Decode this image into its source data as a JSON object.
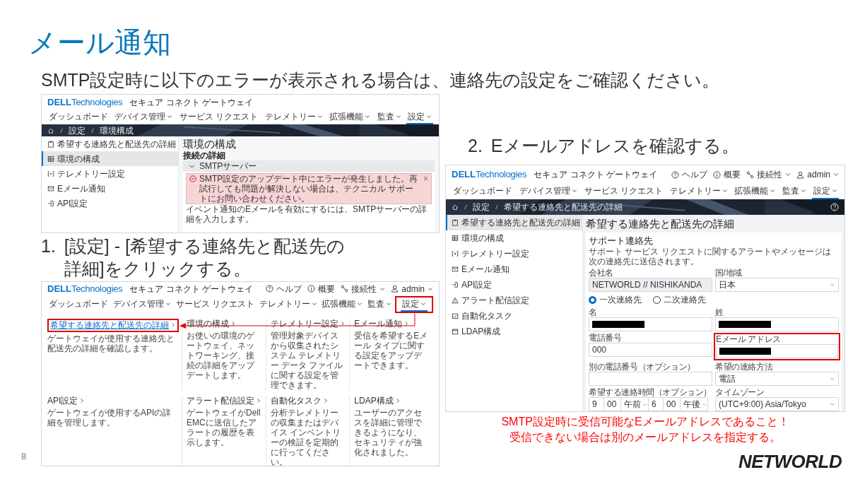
{
  "slide": {
    "title": "メール通知",
    "subtitle": "SMTP設定時に以下のエラーが表示される場合は、連絡先の設定をご確認ください。",
    "page_number": "8",
    "logo": "NETWORLD"
  },
  "step_1": {
    "number": "1.",
    "text": "[設定] - [希望する連絡先と配送先の詳細]をクリックする。"
  },
  "step_2": {
    "number": "2.",
    "text": "Eメールアドレスを確認する。"
  },
  "note": [
    "SMTP設定時に受信可能なEメールアドレスであること！",
    "受信できない場合は別のメールアドレスを指定する。"
  ],
  "screenshot_1": {
    "brand": {
      "mark": "DELL",
      "name": "Technologies"
    },
    "app_title": "セキュア コネクト ゲートウェイ",
    "nav": [
      {
        "label": "ダッシュボード",
        "dropdown": false,
        "selected": false
      },
      {
        "label": "デバイス管理",
        "dropdown": true,
        "selected": false
      },
      {
        "label": "サービス リクエスト",
        "dropdown": false,
        "selected": false
      },
      {
        "label": "テレメトリー",
        "dropdown": true,
        "selected": false
      },
      {
        "label": "拡張機能",
        "dropdown": true,
        "selected": false
      },
      {
        "label": "監査",
        "dropdown": true,
        "selected": false
      },
      {
        "label": "設定",
        "dropdown": true,
        "selected": true
      }
    ],
    "breadcrumb": [
      "設定",
      "環境構成"
    ],
    "sidebar": [
      {
        "label": "希望する連絡先と配送先の詳細",
        "selected": false
      },
      {
        "label": "環境の構成",
        "selected": true
      },
      {
        "label": "テレメトリー設定",
        "selected": false
      },
      {
        "label": "Eメール通知",
        "selected": false
      },
      {
        "label": "API設定",
        "selected": false
      }
    ],
    "heading": "環境の構成",
    "section": "接続の詳細",
    "accordion": {
      "title": "SMTPサーバー",
      "expanded": true
    },
    "error": {
      "message": "SMTP設定のアップデート中にエラーが発生しました。再試行しても問題が解決しない場合は、テクニカル サポートにお問い合わせください。",
      "close": "×"
    },
    "info": "イベント通知のEメールを有効にするには、SMTPサーバーの詳細を入力します。"
  },
  "screenshot_2": {
    "brand": {
      "mark": "DELL",
      "name": "Technologies"
    },
    "app_title": "セキュア コネクト ゲートウェイ",
    "utilities": [
      {
        "label": "ヘルプ",
        "dropdown": false
      },
      {
        "label": "概要",
        "dropdown": false
      },
      {
        "label": "接続性",
        "dropdown": true
      },
      {
        "label": "admin",
        "dropdown": true
      }
    ],
    "nav": [
      {
        "label": "ダッシュボード",
        "dropdown": false,
        "selected": false,
        "highlighted": false
      },
      {
        "label": "デバイス管理",
        "dropdown": true,
        "selected": false,
        "highlighted": false
      },
      {
        "label": "サービス リクエスト",
        "dropdown": false,
        "selected": false,
        "highlighted": false
      },
      {
        "label": "テレメトリー",
        "dropdown": true,
        "selected": false,
        "highlighted": false
      },
      {
        "label": "拡張機能",
        "dropdown": true,
        "selected": false,
        "highlighted": false
      },
      {
        "label": "監査",
        "dropdown": true,
        "selected": false,
        "highlighted": false
      },
      {
        "label": "設定",
        "dropdown": true,
        "selected": true,
        "highlighted": true
      }
    ],
    "menu": [
      {
        "title": "希望する連絡先と配送先の詳細",
        "description": "ゲートウェイが使用する連絡先と配送先の詳細を確認します。",
        "active": true,
        "highlighted": true
      },
      {
        "title": "環境の構成",
        "description": "お使いの環境のゲートウェイ、ネットワーキング、接続の詳細をアップデートします。",
        "active": false,
        "highlighted": false
      },
      {
        "title": "テレメトリー設定",
        "description": "管理対象デバイスから収集されたシステム テレメトリー データ ファイルに関する設定を管理できます。",
        "active": false,
        "highlighted": false
      },
      {
        "title": "Eメール通知",
        "description": "受信を希望するEメール タイプに関する設定をアップデートできます。",
        "active": false,
        "highlighted": false
      },
      {
        "title": "API設定",
        "description": "ゲートウェイが使用するAPIの詳細を管理します。",
        "active": false,
        "highlighted": false
      },
      {
        "title": "アラート配信設定",
        "description": "ゲートウェイがDell EMCに送信したアラートの履歴を表示します。",
        "active": false,
        "highlighted": false
      },
      {
        "title": "自動化タスク",
        "description": "分析テレメトリーの収集またはデバイス インベントリーの検証を定期的に行ってください。",
        "active": false,
        "highlighted": false
      },
      {
        "title": "LDAP構成",
        "description": "ユーザーのアクセスを詳細に管理できるようになり、セキュリティが強化されました。",
        "active": false,
        "highlighted": false
      }
    ]
  },
  "screenshot_3": {
    "brand": {
      "mark": "DELL",
      "name": "Technologies"
    },
    "app_title": "セキュア コネクト ゲートウェイ",
    "utilities": [
      {
        "label": "ヘルプ",
        "dropdown": false
      },
      {
        "label": "概要",
        "dropdown": false
      },
      {
        "label": "接続性",
        "dropdown": true
      },
      {
        "label": "admin",
        "dropdown": true
      }
    ],
    "nav": [
      {
        "label": "ダッシュボード",
        "dropdown": false,
        "selected": false
      },
      {
        "label": "デバイス管理",
        "dropdown": true,
        "selected": false
      },
      {
        "label": "サービス リクエスト",
        "dropdown": false,
        "selected": false
      },
      {
        "label": "テレメトリー",
        "dropdown": true,
        "selected": false
      },
      {
        "label": "拡張機能",
        "dropdown": true,
        "selected": false
      },
      {
        "label": "監査",
        "dropdown": true,
        "selected": false
      },
      {
        "label": "設定",
        "dropdown": true,
        "selected": true
      }
    ],
    "breadcrumb": [
      "設定",
      "希望する連絡先と配送先の詳細"
    ],
    "sidebar": [
      {
        "label": "希望する連絡先と配送先の詳細",
        "selected": true
      },
      {
        "label": "環境の構成",
        "selected": false
      },
      {
        "label": "テレメトリー設定",
        "selected": false
      },
      {
        "label": "Eメール通知",
        "selected": false
      },
      {
        "label": "API設定",
        "selected": false
      },
      {
        "label": "アラート配信設定",
        "selected": false
      },
      {
        "label": "自動化タスク",
        "selected": false
      },
      {
        "label": "LDAP構成",
        "selected": false
      }
    ],
    "heading": "希望する連絡先と配送先の詳細",
    "card": {
      "title": "サポート連絡先",
      "description": "サポート サービス リクエストに関するアラートやメッセージは次の連絡先に送信されます。",
      "fields": [
        {
          "kind": "text",
          "label": "会社名",
          "value": "NETWORLD // NISHIKANDA",
          "disabled": true,
          "redacted": false,
          "highlighted": false
        },
        {
          "kind": "select",
          "label": "国/地域",
          "value": "日本"
        },
        {
          "kind": "radio_group",
          "options": [
            {
              "label": "一次連絡先",
              "selected": true
            },
            {
              "label": "二次連絡先",
              "selected": false
            }
          ]
        },
        {
          "kind": "text",
          "label": "名",
          "disabled": false,
          "redacted": true,
          "highlighted": false
        },
        {
          "kind": "text",
          "label": "姓",
          "disabled": false,
          "redacted": true,
          "highlighted": false
        },
        {
          "kind": "text",
          "label": "電話番号",
          "value": "000",
          "disabled": false,
          "redacted": false,
          "highlighted": false
        },
        {
          "kind": "text",
          "label": "Eメール アドレス",
          "disabled": false,
          "redacted": true,
          "highlighted": true
        },
        {
          "kind": "text",
          "label": "別の電話番号（オプション）",
          "disabled": false,
          "redacted": false,
          "highlighted": false
        },
        {
          "kind": "select",
          "label": "希望の連絡方法",
          "value": "電話"
        },
        {
          "kind": "time_range",
          "label": "希望する連絡時間（オプション）",
          "start": {
            "hour": "9",
            "minute": "00",
            "period": "午前"
          },
          "end": {
            "hour": "6",
            "minute": "00",
            "period": "午後"
          }
        },
        {
          "kind": "select",
          "label": "タイムゾーン",
          "value": "(UTC+9:00) Asia/Tokyo"
        }
      ]
    }
  }
}
